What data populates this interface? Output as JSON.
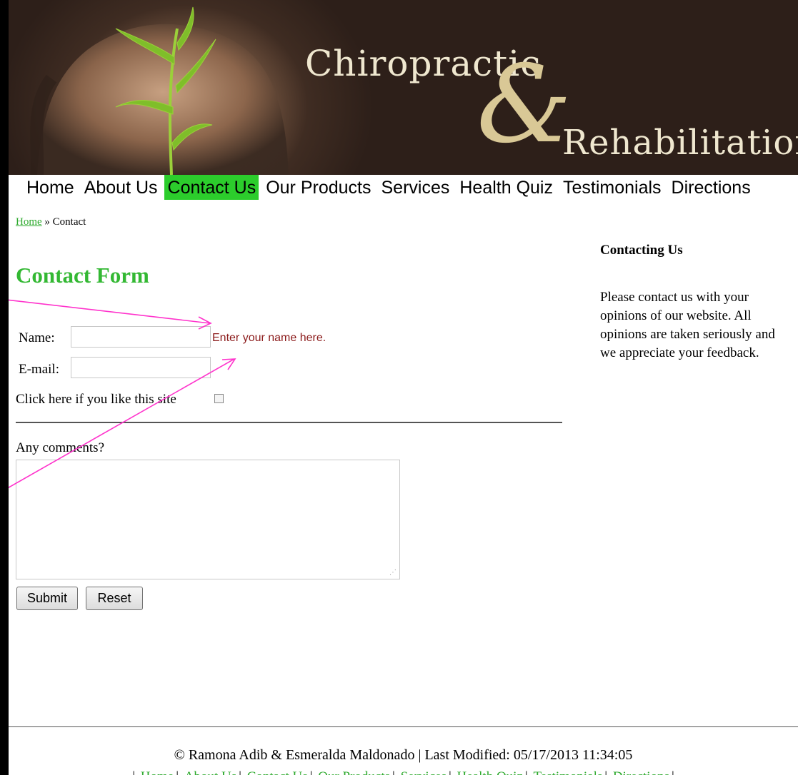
{
  "header": {
    "title_line1": "Chiropractic",
    "ampersand": "&",
    "title_line2": "Rehabilitation"
  },
  "nav": [
    {
      "label": "Home",
      "active": false
    },
    {
      "label": "About Us",
      "active": false
    },
    {
      "label": "Contact Us",
      "active": true
    },
    {
      "label": "Our Products",
      "active": false
    },
    {
      "label": "Services",
      "active": false
    },
    {
      "label": "Health Quiz",
      "active": false
    },
    {
      "label": "Testimonials",
      "active": false
    },
    {
      "label": "Directions",
      "active": false
    }
  ],
  "breadcrumb": {
    "home_link": "Home",
    "separator": "»",
    "current": "Contact"
  },
  "form": {
    "heading": "Contact Form",
    "name_label": "Name:",
    "name_value": "",
    "name_hint": "Enter your name here.",
    "email_label": "E-mail:",
    "email_value": "",
    "like_label": "Click here if you like this site",
    "like_checked": false,
    "comments_label": "Any comments?",
    "comments_value": "",
    "submit_label": "Submit",
    "reset_label": "Reset"
  },
  "sidebar": {
    "heading": "Contacting Us",
    "text": "Please contact us with your opinions of our website. All opinions are taken seriously and we appreciate your feedback."
  },
  "footer": {
    "copyright": "© Ramona Adib & Esmeralda Maldonado | Last Modified: 05/17/2013 11:34:05",
    "links": [
      "Home",
      "About Us",
      "Contact Us",
      "Our Products",
      "Services",
      "Health Quiz",
      "Testimonials",
      "Directions"
    ]
  },
  "colors": {
    "accent_green": "#2ccd2c",
    "link_green": "#2eaa2e",
    "hint_red": "#8b1a1a",
    "annotation_pink": "#ff33cc",
    "header_brown": "#2d1f19"
  }
}
